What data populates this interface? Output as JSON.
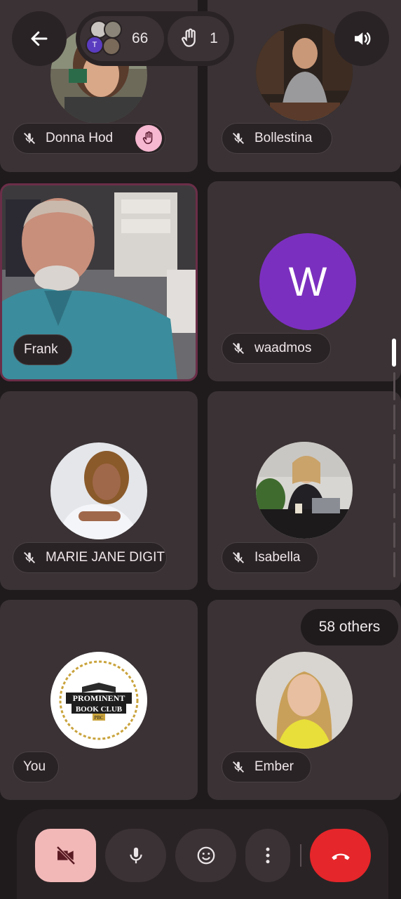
{
  "top_bar": {
    "participant_count": "66",
    "raised_hands": "1",
    "avatar_initial": "T"
  },
  "tiles": {
    "donna": {
      "name": "Donna Hod"
    },
    "bollestina": {
      "name": "Bollestina"
    },
    "frank": {
      "name": "Frank"
    },
    "waadmos": {
      "name": "waadmos",
      "initial": "W"
    },
    "marie": {
      "name": "MARIE JANE DIGIT"
    },
    "isabella": {
      "name": "Isabella"
    },
    "you": {
      "name": "You",
      "logo_line1": "PROMINENT",
      "logo_line2": "BOOK CLUB",
      "logo_line3": "PBC"
    },
    "ember": {
      "name": "Ember",
      "others_badge": "58 others"
    }
  },
  "colors": {
    "accent_purple": "#7b2fbf",
    "end_call_red": "#e5262a",
    "camera_off_bg": "#f2b8b8",
    "hand_raised_bg": "#f6b7d0"
  }
}
